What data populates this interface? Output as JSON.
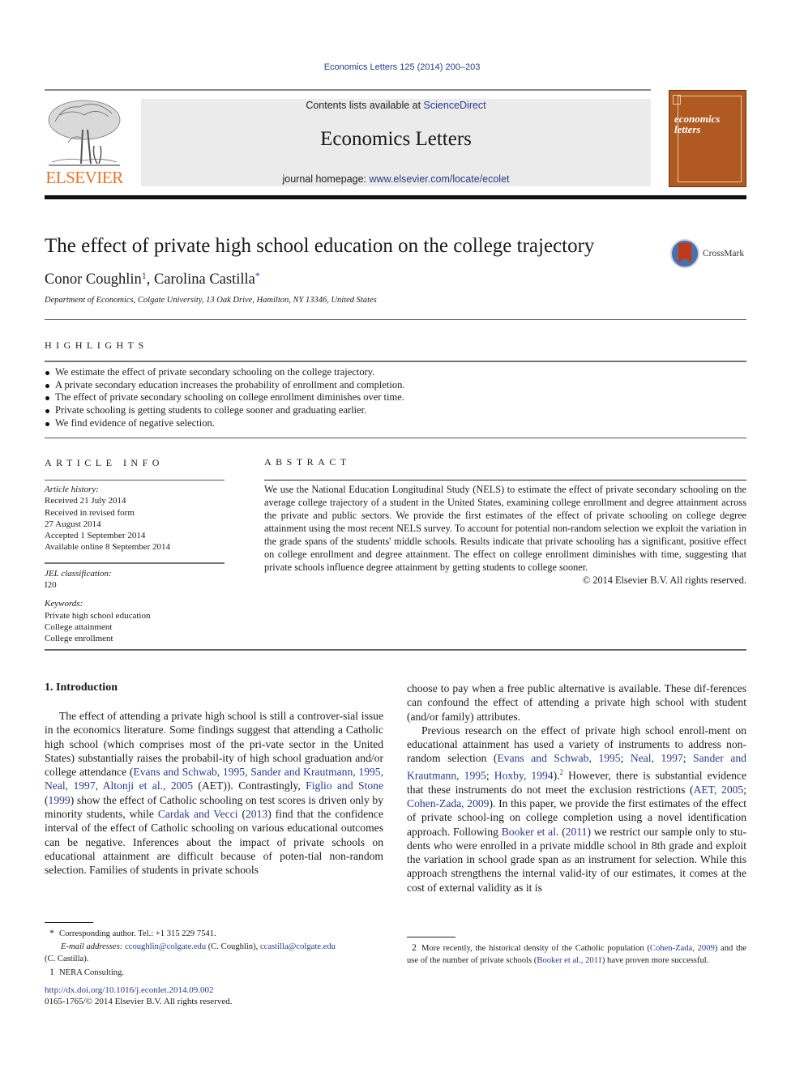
{
  "header": {
    "journal_ref": "Economics Letters 125 (2014) 200–203",
    "contents_prefix": "Contents lists available at ",
    "contents_link": "ScienceDirect",
    "journal_title": "Economics Letters",
    "homepage_prefix": "journal homepage: ",
    "homepage_link": "www.elsevier.com/locate/ecolet",
    "publisher_logo_text": "ELSEVIER",
    "cover_title_line1": "economics",
    "cover_title_line2": "letters"
  },
  "article": {
    "title": "The effect of private high school education on the college trajectory",
    "crossmark_label": "CrossMark",
    "authors": [
      {
        "name": "Conor Coughlin",
        "mark": "1"
      },
      {
        "name": "Carolina Castilla",
        "mark": "*"
      }
    ],
    "author_separator": ", ",
    "affiliation": "Department of Economics, Colgate University, 13 Oak Drive, Hamilton, NY 13346, United States"
  },
  "highlights": {
    "heading": "HIGHLIGHTS",
    "items": [
      "We estimate the effect of private secondary schooling on the college trajectory.",
      "A private secondary education increases the probability of enrollment and completion.",
      "The effect of private secondary schooling on college enrollment diminishes over time.",
      "Private schooling is getting students to college sooner and graduating earlier.",
      "We find evidence of negative selection."
    ]
  },
  "article_info": {
    "heading": "ARTICLE INFO",
    "history_label": "Article history:",
    "history": [
      "Received 21 July 2014",
      "Received in revised form",
      "27 August 2014",
      "Accepted 1 September 2014",
      "Available online 8 September 2014"
    ],
    "jel_label": "JEL classification:",
    "jel": "I20",
    "keywords_label": "Keywords:",
    "keywords": [
      "Private high school education",
      "College attainment",
      "College enrollment"
    ]
  },
  "abstract": {
    "heading": "ABSTRACT",
    "text": "We use the National Education Longitudinal Study (NELS) to estimate the effect of private secondary schooling on the average college trajectory of a student in the United States, examining college enrollment and degree attainment across the private and public sectors. We provide the first estimates of the effect of private schooling on college degree attainment using the most recent NELS survey. To account for potential non-random selection we exploit the variation in the grade spans of the students' middle schools. Results indicate that private schooling has a significant, positive effect on college enrollment and degree attainment. The effect on college enrollment diminishes with time, suggesting that private schools influence degree attainment by getting students to college sooner.",
    "copyright": "© 2014 Elsevier B.V. All rights reserved."
  },
  "introduction": {
    "heading": "1.  Introduction",
    "left_col": {
      "t1": "The effect of attending a private high school is still a controver-sial issue in the economics literature. Some findings suggest that attending a Catholic high school (which comprises most of the pri-vate sector in the United States) substantially raises the probabil-ity of high school graduation and/or college attendance (",
      "c1": "Evans and Schwab, 1995, Sander and Krautmann, 1995, Neal, 1997, Altonji et al., 2005",
      "t2": " (AET)). Contrastingly, ",
      "c2": "Figlio and Stone",
      "t3": " (",
      "c3": "1999",
      "t4": ") show the effect of Catholic schooling on test scores is driven only by minority students, while ",
      "c4": "Cardak and Vecci",
      "t5": " (",
      "c5": "2013",
      "t6": ") find that the confidence interval of the effect of Catholic schooling on various educational outcomes can be negative. Inferences about the impact of private schools on educational attainment are difficult because of poten-tial non-random selection. Families of students in private schools"
    },
    "right_col": {
      "p1": "choose to pay when a free public alternative is available. These dif-ferences can confound the effect of attending a private high school with student (and/or family) attributes.",
      "t1": "Previous research on the effect of private high school enroll-ment on educational attainment has used a variety of instruments to address non-random selection (",
      "c1": "Evans and Schwab, 1995",
      "s1": "; ",
      "c2": "Neal, 1997",
      "s2": "; ",
      "c3": "Sander and Krautmann, 1995",
      "s3": "; ",
      "c4": "Hoxby, 1994",
      "t2": ").",
      "fn": "2",
      "t3": " However, there is substantial evidence that these instruments do not meet the exclusion restrictions (",
      "c5": "AET, 2005",
      "s4": "; ",
      "c6": "Cohen-Zada, 2009",
      "t4": "). In this paper, we provide the first estimates of the effect of private school-ing on college completion using a novel identification approach. Following ",
      "c7": "Booker et al.",
      "t5": " (",
      "c8": "2011",
      "t6": ") we restrict our sample only to stu-dents who were enrolled in a private middle school in 8th grade and exploit the variation in school grade span as an instrument for selection. While this approach strengthens the internal valid-ity of our estimates, it comes at the cost of external validity as it is"
    }
  },
  "footnotes": {
    "corresponding_mark": "*",
    "corresponding": "Corresponding author. Tel.: +1 315 229 7541.",
    "email_label": "E-mail addresses:",
    "email1": "ccoughlin@colgate.edu",
    "email1_name": " (C. Coughlin), ",
    "email2": "ccastilla@colgate.edu",
    "email2_name": "(C. Castilla).",
    "fn1_mark": "1",
    "fn1": "NERA Consulting.",
    "fn2_mark": "2",
    "fn2_t1": "More recently, the historical density of the Catholic population (",
    "fn2_c1": "Cohen-Zada, 2009",
    "fn2_t2": ") and the use of the number of private schools (",
    "fn2_c2": "Booker et al., 2011",
    "fn2_t3": ") have proven more successful."
  },
  "doi": {
    "link": "http://dx.doi.org/10.1016/j.econlet.2014.09.002",
    "issn": "0165-1765/© 2014 Elsevier B.V. All rights reserved."
  },
  "colors": {
    "link": "#2a3a8c",
    "elsevier_orange": "#e8732a",
    "cover_brown": "#b05a22",
    "crossmark_red": "#c0391b"
  }
}
